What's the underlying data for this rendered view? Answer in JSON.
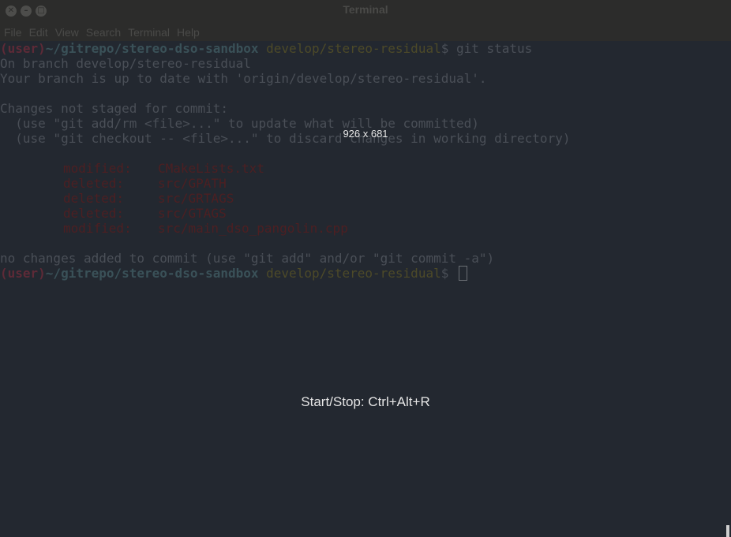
{
  "window": {
    "title": "Terminal",
    "buttons": {
      "close": "✕",
      "minimize": "–",
      "maximize": "□"
    }
  },
  "menu": {
    "items": [
      "File",
      "Edit",
      "View",
      "Search",
      "Terminal",
      "Help"
    ]
  },
  "prompt": {
    "user": "(user)",
    "path": "~/gitrepo/stereo-dso-sandbox",
    "branch": "develop/stereo-residual",
    "suffix": "$ "
  },
  "command": "git status",
  "output": {
    "on_branch": "On branch develop/stereo-residual",
    "up_to_date": "Your branch is up to date with 'origin/develop/stereo-residual'.",
    "changes_header": "Changes not staged for commit:",
    "hint1": "  (use \"git add/rm <file>...\" to update what will be committed)",
    "hint2": "  (use \"git checkout -- <file>...\" to discard changes in working directory)",
    "files": [
      {
        "status": "modified:",
        "path": "CMakeLists.txt"
      },
      {
        "status": "deleted:",
        "path": "src/GPATH"
      },
      {
        "status": "deleted:",
        "path": "src/GRTAGS"
      },
      {
        "status": "deleted:",
        "path": "src/GTAGS"
      },
      {
        "status": "modified:",
        "path": "src/main_dso_pangolin.cpp"
      }
    ],
    "no_changes": "no changes added to commit (use \"git add\" and/or \"git commit -a\")"
  },
  "overlay": {
    "size": "926 x 681",
    "hint": "Start/Stop: Ctrl+Alt+R"
  }
}
